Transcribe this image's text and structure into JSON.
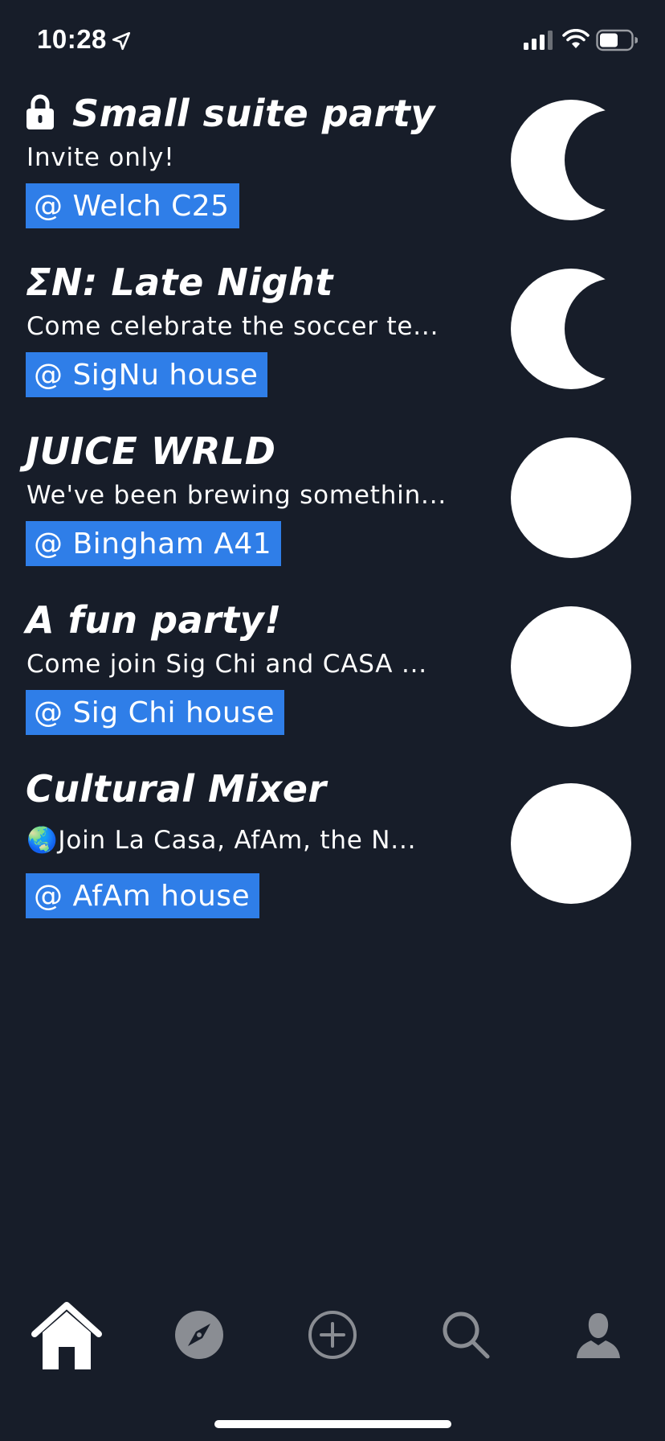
{
  "status_bar": {
    "time": "10:28",
    "icons": [
      "location-arrow-icon",
      "cellular-signal-icon",
      "wifi-icon",
      "battery-icon"
    ]
  },
  "events": [
    {
      "title": "Small suite party",
      "description": "Invite only!",
      "location": "@ Welch C25",
      "private": true,
      "moon_phase": "crescent"
    },
    {
      "title": "ΣN: Late Night",
      "description": "Come celebrate the soccer te...",
      "location": "@ SigNu house",
      "private": false,
      "moon_phase": "crescent"
    },
    {
      "title": "JUICE WRLD",
      "description": "We've been brewing somethin...",
      "location": "@ Bingham A41",
      "private": false,
      "moon_phase": "full"
    },
    {
      "title": "A fun party!",
      "description": "Come join Sig Chi and CASA ...",
      "location": "@ Sig Chi house",
      "private": false,
      "moon_phase": "full"
    },
    {
      "title": "Cultural Mixer",
      "description": "🌏Join La Casa, AfAm, the N...",
      "location": "@ AfAm house",
      "private": false,
      "moon_phase": "full"
    }
  ],
  "tab_bar": {
    "tabs": [
      "home-icon",
      "compass-icon",
      "add-circle-icon",
      "search-icon",
      "profile-icon"
    ],
    "active": "home-icon"
  },
  "colors": {
    "background": "#171d29",
    "location_badge": "#2f7ee8",
    "inactive_tab": "#8a8d93",
    "text": "#ffffff"
  }
}
